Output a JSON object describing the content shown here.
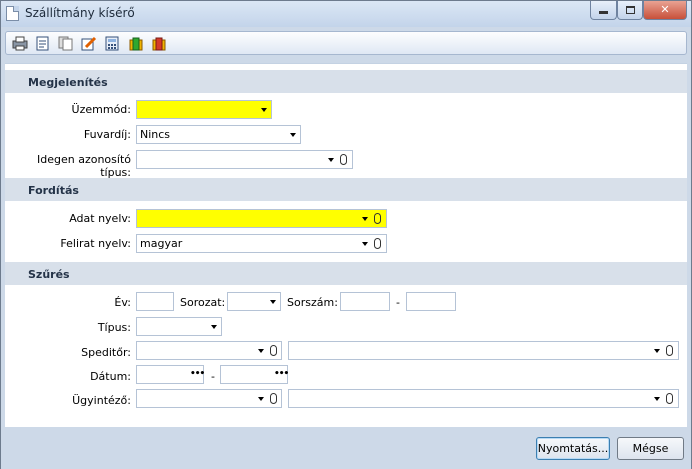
{
  "window": {
    "title": "Szállítmány kísérő"
  },
  "toolbar": {
    "icons": [
      "print-icon",
      "edit-document-icon",
      "copy-document-icon",
      "notes-icon",
      "calculator-icon",
      "green-box-icon",
      "red-box-icon"
    ]
  },
  "sections": {
    "display": "Megjelenítés",
    "translation": "Fordítás",
    "filter": "Szűrés"
  },
  "display": {
    "mode_label": "Üzemmód:",
    "mode_value": "",
    "freight_label": "Fuvardíj:",
    "freight_value": "Nincs",
    "foreign_id_label": "Idegen azonosító típus:",
    "foreign_id_value": ""
  },
  "translation": {
    "data_lang_label": "Adat nyelv:",
    "data_lang_value": "",
    "caption_lang_label": "Felirat nyelv:",
    "caption_lang_value": "magyar"
  },
  "filter": {
    "year_label": "Év:",
    "series_label": "Sorozat:",
    "serial_label": "Sorszám:",
    "range_sep": "-",
    "type_label": "Típus:",
    "forwarder_label": "Speditőr:",
    "date_label": "Dátum:",
    "date_sep": "-",
    "administrator_label": "Ügyintéző:",
    "ellipsis": "•••"
  },
  "buttons": {
    "print": "Nyomtatás...",
    "cancel": "Mégse"
  },
  "colors": {
    "required_field": "#ffff00",
    "section_bg": "#d8e0ea",
    "window_bg": "#cdd9e8"
  }
}
